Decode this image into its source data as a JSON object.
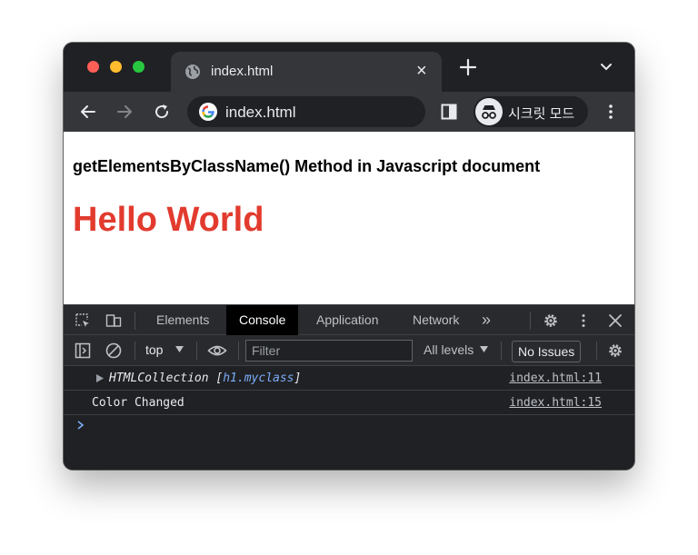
{
  "browser": {
    "tab": {
      "title": "index.html",
      "close_glyph": "×"
    },
    "address_bar": {
      "url": "index.html"
    },
    "incognito": {
      "label": "시크릿 모드"
    }
  },
  "page": {
    "heading": "getElementsByClassName() Method in Javascript document",
    "title": "Hello World",
    "title_color": "#e23b2e"
  },
  "devtools": {
    "tabs": [
      {
        "label": "Elements"
      },
      {
        "label": "Console",
        "active": true
      },
      {
        "label": "Application"
      },
      {
        "label": "Network"
      }
    ],
    "more_tabs_glyph": "»",
    "console_toolbar": {
      "context": "top",
      "filter_placeholder": "Filter",
      "levels": "All levels",
      "issues": "No Issues"
    },
    "logs": [
      {
        "class_name": "HTMLCollection",
        "open_bracket": "[",
        "node": "h1.myclass",
        "close_bracket": "]",
        "source": "index.html:11"
      },
      {
        "message": "Color Changed",
        "source": "index.html:15"
      }
    ]
  },
  "colors": {
    "window_frame": "#202124",
    "toolbar": "#35363a",
    "accent_link": "#7cacf8"
  },
  "icons": [
    "globe-icon",
    "close-icon",
    "plus-icon",
    "chevron-down-icon",
    "back-arrow-icon",
    "forward-arrow-icon",
    "reload-icon",
    "google-logo-icon",
    "side-panel-icon",
    "incognito-icon",
    "more-vert-icon",
    "inspect-icon",
    "device-toggle-icon",
    "gear-icon",
    "sidebar-toggle-icon",
    "clear-console-icon",
    "eye-icon",
    "prompt-chevron-icon"
  ]
}
